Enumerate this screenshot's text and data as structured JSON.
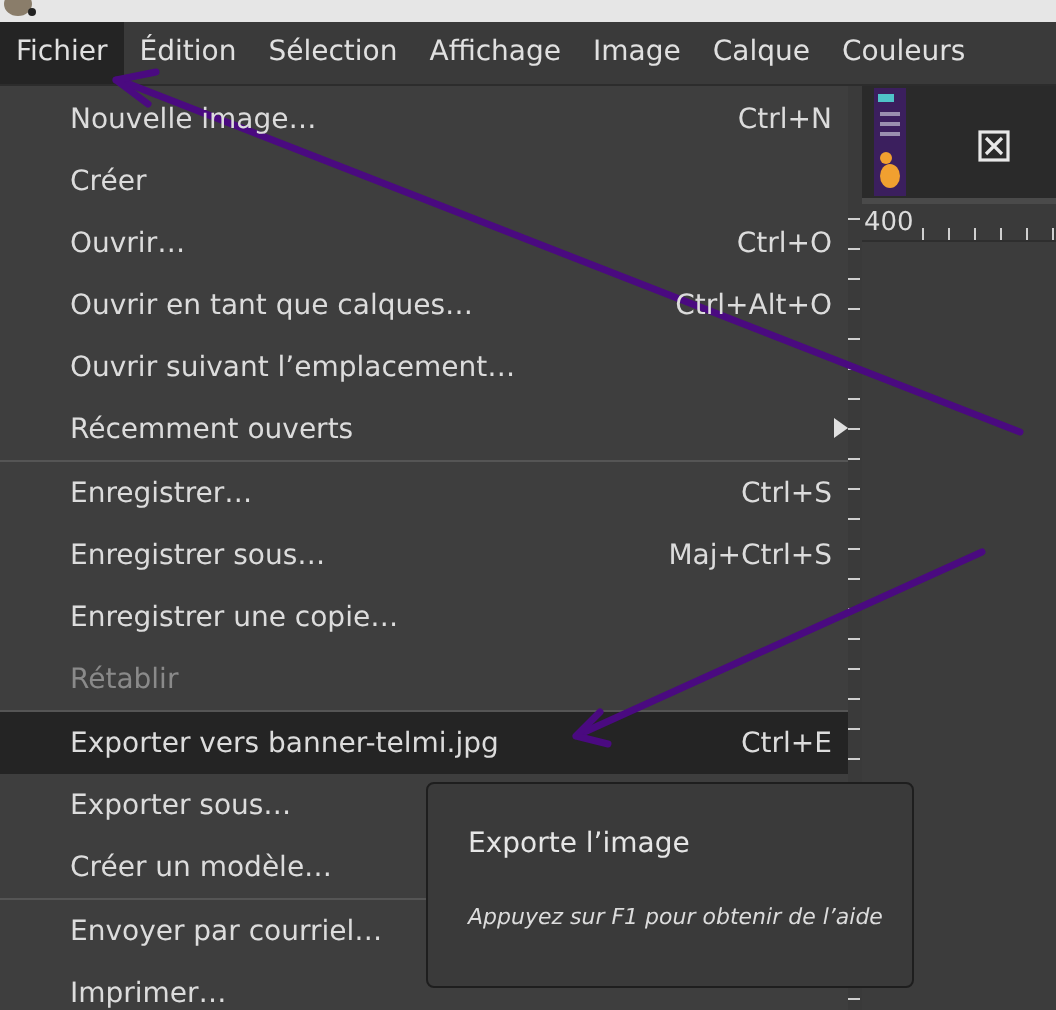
{
  "menubar": [
    {
      "label": "Fichier",
      "selected": true
    },
    {
      "label": "Édition",
      "selected": false
    },
    {
      "label": "Sélection",
      "selected": false
    },
    {
      "label": "Affichage",
      "selected": false
    },
    {
      "label": "Image",
      "selected": false
    },
    {
      "label": "Calque",
      "selected": false
    },
    {
      "label": "Couleurs",
      "selected": false
    }
  ],
  "menu": [
    {
      "kind": "item",
      "label": "Nouvelle image…",
      "shortcut": "Ctrl+N",
      "disabled": false,
      "selected": false,
      "submenu": false
    },
    {
      "kind": "item",
      "label": "Créer",
      "disabled": false,
      "selected": false,
      "submenu": false
    },
    {
      "kind": "item",
      "label": "Ouvrir…",
      "shortcut": "Ctrl+O",
      "disabled": false,
      "selected": false,
      "submenu": false
    },
    {
      "kind": "item",
      "label": "Ouvrir en tant que calques…",
      "shortcut": "Ctrl+Alt+O",
      "disabled": false,
      "selected": false,
      "submenu": false
    },
    {
      "kind": "item",
      "label": "Ouvrir suivant l’emplacement…",
      "disabled": false,
      "selected": false,
      "submenu": false
    },
    {
      "kind": "item",
      "label": "Récemment ouverts",
      "disabled": false,
      "selected": false,
      "submenu": true
    },
    {
      "kind": "separator"
    },
    {
      "kind": "item",
      "label": "Enregistrer…",
      "shortcut": "Ctrl+S",
      "disabled": false,
      "selected": false,
      "submenu": false
    },
    {
      "kind": "item",
      "label": "Enregistrer sous…",
      "shortcut": "Maj+Ctrl+S",
      "disabled": false,
      "selected": false,
      "submenu": false
    },
    {
      "kind": "item",
      "label": "Enregistrer une copie…",
      "disabled": false,
      "selected": false,
      "submenu": false
    },
    {
      "kind": "item",
      "label": "Rétablir",
      "disabled": true,
      "selected": false,
      "submenu": false
    },
    {
      "kind": "separator"
    },
    {
      "kind": "item",
      "label": "Exporter vers banner-telmi.jpg",
      "shortcut": "Ctrl+E",
      "disabled": false,
      "selected": true,
      "submenu": false
    },
    {
      "kind": "item",
      "label": "Exporter sous…",
      "disabled": false,
      "selected": false,
      "submenu": false
    },
    {
      "kind": "item",
      "label": "Créer un modèle…",
      "disabled": false,
      "selected": false,
      "submenu": false
    },
    {
      "kind": "separator"
    },
    {
      "kind": "item",
      "label": "Envoyer par courriel…",
      "disabled": false,
      "selected": false,
      "submenu": false
    },
    {
      "kind": "item",
      "label": "Imprimer…",
      "disabled": false,
      "selected": false,
      "submenu": false
    }
  ],
  "ruler": {
    "label": "400"
  },
  "tooltip": {
    "title": "Exporte l’image",
    "hint": "Appuyez sur F1 pour obtenir de l’aide"
  }
}
